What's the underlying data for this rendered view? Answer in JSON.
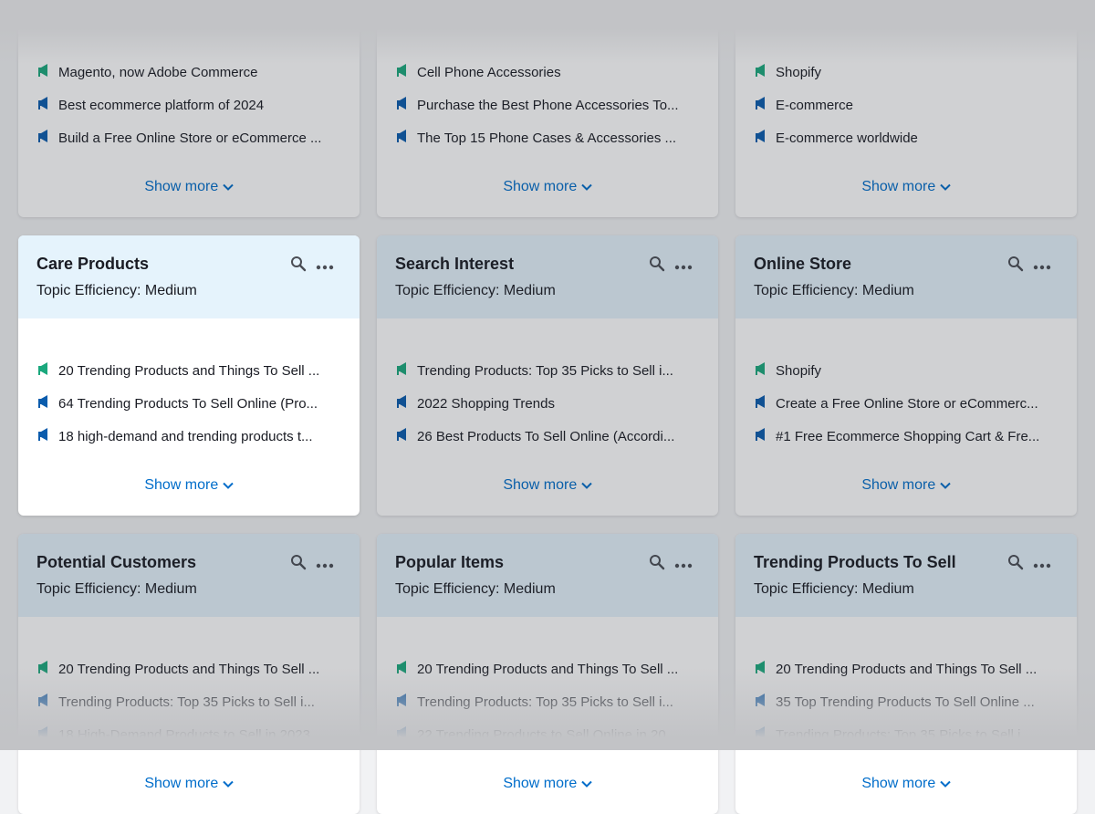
{
  "colors": {
    "accent": "#006dca",
    "green_icon": "#1aa87d",
    "blue_icon": "#0a5cad",
    "header_bg": "#e5f3fc"
  },
  "show_more_label": "Show more",
  "cards": [
    {
      "title": "",
      "subtitle": "",
      "items": [
        "Magento, now Adobe Commerce",
        "Best ecommerce platform of 2024",
        "Build a Free Online Store or eCommerce ..."
      ]
    },
    {
      "title": "",
      "subtitle": "",
      "items": [
        "Cell Phone Accessories",
        "Purchase the Best Phone Accessories To...",
        "The Top 15 Phone Cases & Accessories ..."
      ]
    },
    {
      "title": "",
      "subtitle": "",
      "items": [
        "Shopify",
        "E-commerce",
        "E-commerce worldwide"
      ]
    },
    {
      "title": "Care Products",
      "subtitle": "Topic Efficiency: Medium",
      "items": [
        "20 Trending Products and Things To Sell ...",
        "64 Trending Products To Sell Online (Pro...",
        "18 high-demand and trending products t..."
      ]
    },
    {
      "title": "Search Interest",
      "subtitle": "Topic Efficiency: Medium",
      "items": [
        "Trending Products: Top 35 Picks to Sell i...",
        "2022 Shopping Trends",
        "26 Best Products To Sell Online (Accordi..."
      ]
    },
    {
      "title": "Online Store",
      "subtitle": "Topic Efficiency: Medium",
      "items": [
        "Shopify",
        "Create a Free Online Store or eCommerc...",
        "#1 Free Ecommerce Shopping Cart & Fre..."
      ]
    },
    {
      "title": "Potential Customers",
      "subtitle": "Topic Efficiency: Medium",
      "items": [
        "20 Trending Products and Things To Sell ...",
        "Trending Products: Top 35 Picks to Sell i...",
        "18 High-Demand Products to Sell in 2023..."
      ]
    },
    {
      "title": "Popular Items",
      "subtitle": "Topic Efficiency: Medium",
      "items": [
        "20 Trending Products and Things To Sell ...",
        "Trending Products: Top 35 Picks to Sell i...",
        "22 Trending Products to Sell Online in 20..."
      ]
    },
    {
      "title": "Trending Products To Sell",
      "subtitle": "Topic Efficiency: Medium",
      "items": [
        "20 Trending Products and Things To Sell ...",
        "35 Top Trending Products To Sell Online ...",
        "Trending Products: Top 35 Picks to Sell i..."
      ]
    }
  ]
}
